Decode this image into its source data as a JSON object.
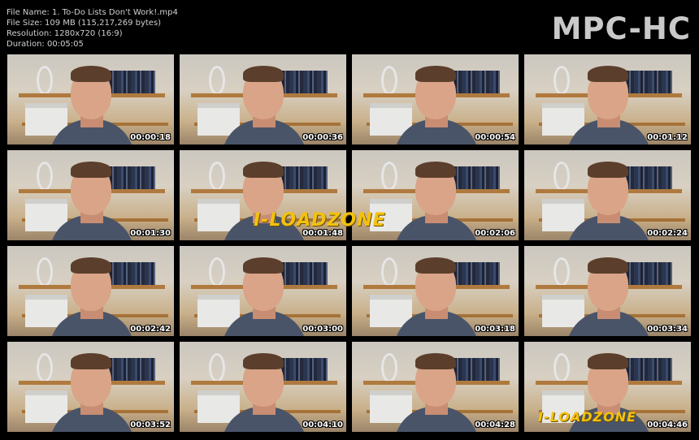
{
  "info": {
    "file_name": "File Name: 1. To-Do Lists Don't Work!.mp4",
    "file_size": "File Size: 109 MB (115,217,269 bytes)",
    "resolution": "Resolution: 1280x720 (16:9)",
    "duration": "Duration: 00:05:05"
  },
  "logo": "MPC-HC",
  "watermark": "I-LOADZONE",
  "thumbnails": [
    "00:00:18",
    "00:00:36",
    "00:00:54",
    "00:01:12",
    "00:01:30",
    "00:01:48",
    "00:02:06",
    "00:02:24",
    "00:02:42",
    "00:03:00",
    "00:03:18",
    "00:03:34",
    "00:03:52",
    "00:04:10",
    "00:04:28",
    "00:04:46"
  ]
}
